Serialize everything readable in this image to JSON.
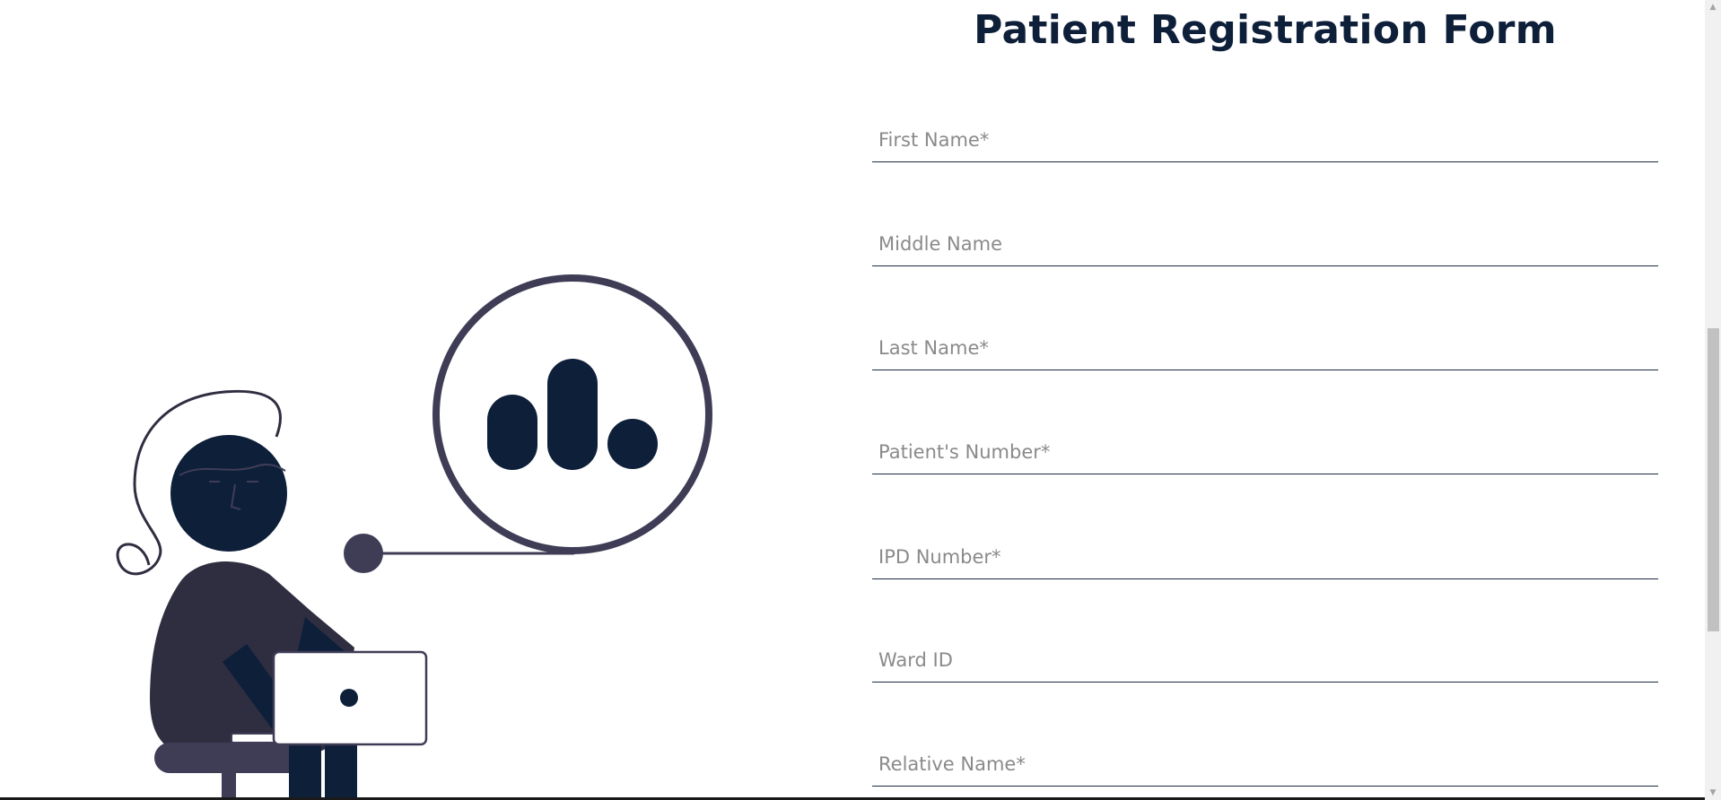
{
  "form": {
    "title": "Patient Registration Form",
    "fields": [
      {
        "placeholder": "First Name*",
        "value": ""
      },
      {
        "placeholder": "Middle Name",
        "value": ""
      },
      {
        "placeholder": "Last Name*",
        "value": ""
      },
      {
        "placeholder": "Patient's Number*",
        "value": ""
      },
      {
        "placeholder": "IPD Number*",
        "value": ""
      },
      {
        "placeholder": "Ward ID",
        "value": ""
      },
      {
        "placeholder": "Relative Name*",
        "value": ""
      }
    ]
  },
  "illustration": {
    "icon": "person-laptop-chart-icon"
  },
  "colors": {
    "navy": "#0e1f3a",
    "dark_purple": "#3f3d56",
    "body_purple": "#2f2e41",
    "field_underline": "#1c2a44",
    "placeholder": "#8a8a8a"
  }
}
